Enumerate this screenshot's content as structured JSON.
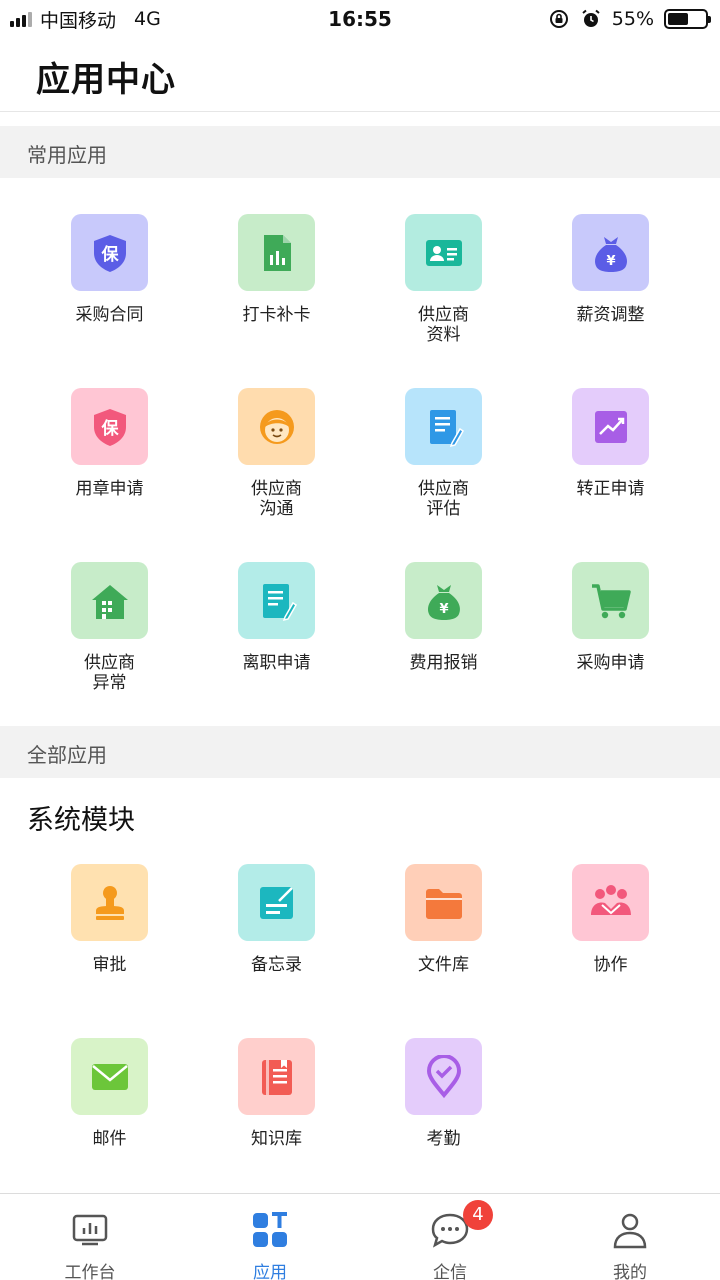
{
  "status_bar": {
    "carrier": "中国移动",
    "network": "4G",
    "time": "16:55",
    "battery": "55%",
    "battery_level": 0.55
  },
  "header": {
    "title": "应用中心"
  },
  "sections": {
    "frequent": "常用应用",
    "all": "全部应用",
    "system_modules": "系统模块"
  },
  "frequent_apps": [
    {
      "label": "采购合同",
      "icon": "shield-bao-icon",
      "bg": "#c8c9fb",
      "fg": "#5b5de6"
    },
    {
      "label": "打卡补卡",
      "icon": "chart-document-icon",
      "bg": "#c7ecc9",
      "fg": "#3faa58"
    },
    {
      "label": "供应商\n资料",
      "icon": "id-card-icon",
      "bg": "#b3ece0",
      "fg": "#19b79a"
    },
    {
      "label": "薪资调整",
      "icon": "money-bag-icon",
      "bg": "#c8c9fb",
      "fg": "#5b5de6"
    },
    {
      "label": "用章申请",
      "icon": "shield-bao-icon",
      "bg": "#ffc6d4",
      "fg": "#f2587c"
    },
    {
      "label": "供应商\n沟通",
      "icon": "customer-service-icon",
      "bg": "#ffdcae",
      "fg": "#f59a1d"
    },
    {
      "label": "供应商\n评估",
      "icon": "document-edit-icon",
      "bg": "#b7e4fb",
      "fg": "#2f98e6"
    },
    {
      "label": "转正申请",
      "icon": "growth-chart-icon",
      "bg": "#e4ccfb",
      "fg": "#a85ee6"
    },
    {
      "label": "供应商\n异常",
      "icon": "building-icon",
      "bg": "#c7ecc9",
      "fg": "#3faa58"
    },
    {
      "label": "离职申请",
      "icon": "document-edit-icon",
      "bg": "#b3ece8",
      "fg": "#1cb7bf"
    },
    {
      "label": "费用报销",
      "icon": "money-bag-icon",
      "bg": "#c7ecc9",
      "fg": "#3faa58"
    },
    {
      "label": "采购申请",
      "icon": "shopping-cart-icon",
      "bg": "#c7ecc9",
      "fg": "#3faa58"
    }
  ],
  "system_apps": [
    {
      "label": "审批",
      "icon": "stamp-icon",
      "bg": "#ffe1b0",
      "fg": "#f59a1d"
    },
    {
      "label": "备忘录",
      "icon": "memo-icon",
      "bg": "#b3ece8",
      "fg": "#1cb7bf"
    },
    {
      "label": "文件库",
      "icon": "folder-icon",
      "bg": "#ffcfb8",
      "fg": "#f47a3c"
    },
    {
      "label": "协作",
      "icon": "team-icon",
      "bg": "#ffc6d4",
      "fg": "#f2587c"
    },
    {
      "label": "邮件",
      "icon": "mail-icon",
      "bg": "#d8f3c8",
      "fg": "#6cc63a"
    },
    {
      "label": "知识库",
      "icon": "knowledge-book-icon",
      "bg": "#ffcfcc",
      "fg": "#f25c54"
    },
    {
      "label": "考勤",
      "icon": "location-check-icon",
      "bg": "#e4ccfb",
      "fg": "#a85ee6"
    }
  ],
  "tabs": [
    {
      "label": "工作台",
      "icon": "workbench-icon",
      "active": false
    },
    {
      "label": "应用",
      "icon": "apps-icon",
      "active": true
    },
    {
      "label": "企信",
      "icon": "chat-icon",
      "active": false,
      "badge": "4"
    },
    {
      "label": "我的",
      "icon": "user-icon",
      "active": false
    }
  ],
  "colors": {
    "accent": "#2f7ee0",
    "badge": "#f0423a"
  }
}
